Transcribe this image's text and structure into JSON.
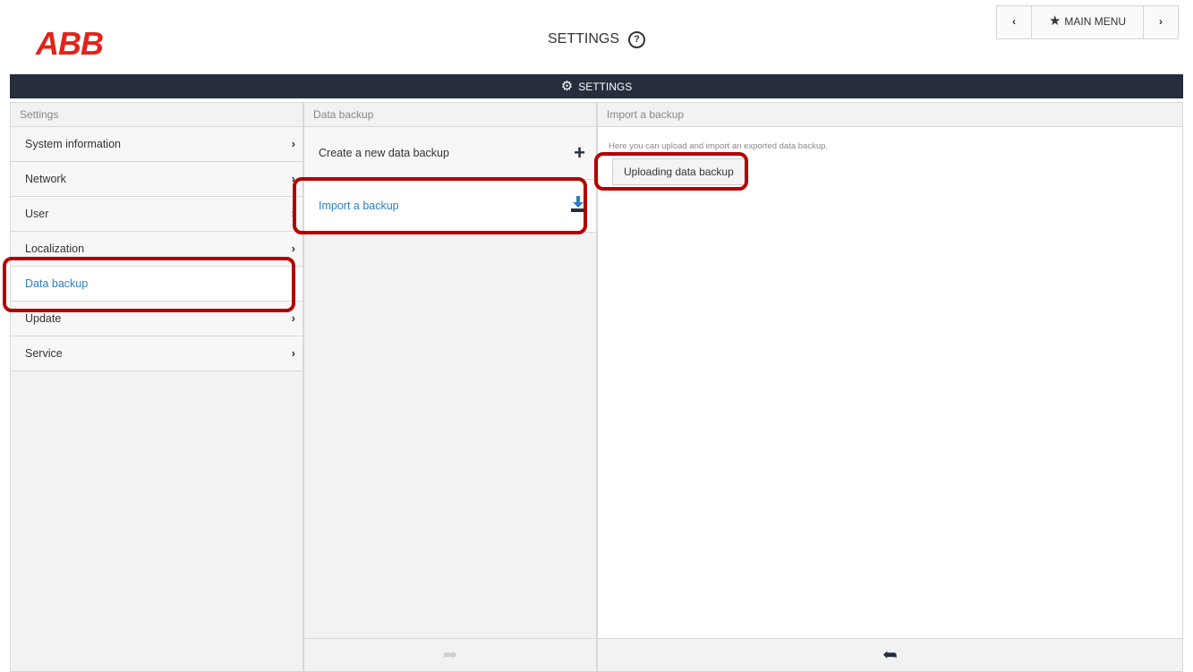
{
  "header": {
    "logo_text": "ABB",
    "title": "SETTINGS",
    "help_icon": "?",
    "nav": {
      "prev": "‹",
      "main_menu": "MAIN MENU",
      "next": "›"
    }
  },
  "bar": {
    "label": "SETTINGS"
  },
  "columns": {
    "settings": {
      "header": "Settings",
      "items": [
        {
          "label": "System information"
        },
        {
          "label": "Network"
        },
        {
          "label": "User"
        },
        {
          "label": "Localization"
        },
        {
          "label": "Data backup",
          "active": true
        },
        {
          "label": "Update"
        },
        {
          "label": "Service"
        }
      ]
    },
    "backup": {
      "header": "Data backup",
      "items": [
        {
          "label": "Create a new data backup",
          "icon": "plus-icon"
        },
        {
          "label": "Import a backup",
          "icon": "download-icon",
          "active": true
        }
      ]
    },
    "import": {
      "header": "Import a backup",
      "description": "Here you can upload and import an exported data backup.",
      "button_label": "Uploading data backup"
    }
  },
  "colors": {
    "accent": "#2d7fc1",
    "bar_bg": "#262d3d",
    "logo": "#e2231a",
    "highlight": "#b30000"
  }
}
